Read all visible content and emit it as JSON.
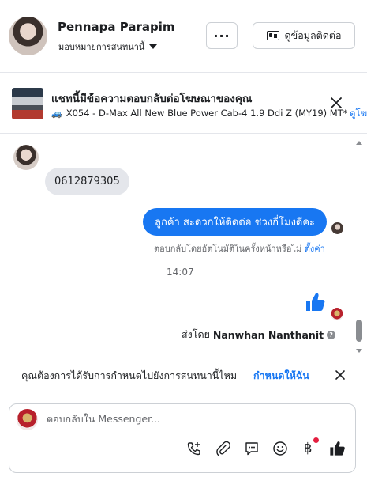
{
  "header": {
    "contact_name": "Pennapa Parapim",
    "assign_label": "มอบหมายการสนทนานี้",
    "more_label": "···",
    "contact_info_label": "ดูข้อมูลติดต่อ"
  },
  "ad": {
    "title": "แชทนี้มีข้อความตอบกลับต่อโฆษณาของคุณ",
    "subtitle": "X054 - D-Max All New Blue Power Cab-4 1.9 Ddi Z (MY19) MT*...",
    "link": "ดูโฆ"
  },
  "messages": {
    "incoming_text": "0612879305",
    "outgoing_text": "ลูกค้า  สะดวกให้ติดต่อ ช่วงกี่โมงดีคะ",
    "auto_reply_note": "ตอบกลับโดยอัตโนมัติในครั้งหน้าหรือไม่",
    "auto_reply_link": "ตั้งค่า",
    "timestamp": "14:07",
    "sent_by_prefix": "ส่งโดย",
    "sent_by_name": "Nanwhan Nanthanit",
    "info_glyph": "?"
  },
  "assign_bar": {
    "prompt": "คุณต้องการได้รับการกำหนดไปยังการสนทนานี้ไหม",
    "link": "กำหนดให้ฉัน"
  },
  "composer": {
    "placeholder": "ตอบกลับใน Messenger...",
    "baht_symbol": "฿"
  },
  "colors": {
    "accent": "#1877f2",
    "bubble_incoming": "#e4e6eb",
    "notification_dot": "#e41e3f"
  },
  "icons": [
    "more-icon",
    "contact-card-icon",
    "chevron-down-icon",
    "close-icon",
    "truck-icon",
    "thumbs-up-icon",
    "info-icon",
    "call-add-icon",
    "attachment-icon",
    "saved-reply-icon",
    "emoji-icon",
    "payment-icon"
  ]
}
